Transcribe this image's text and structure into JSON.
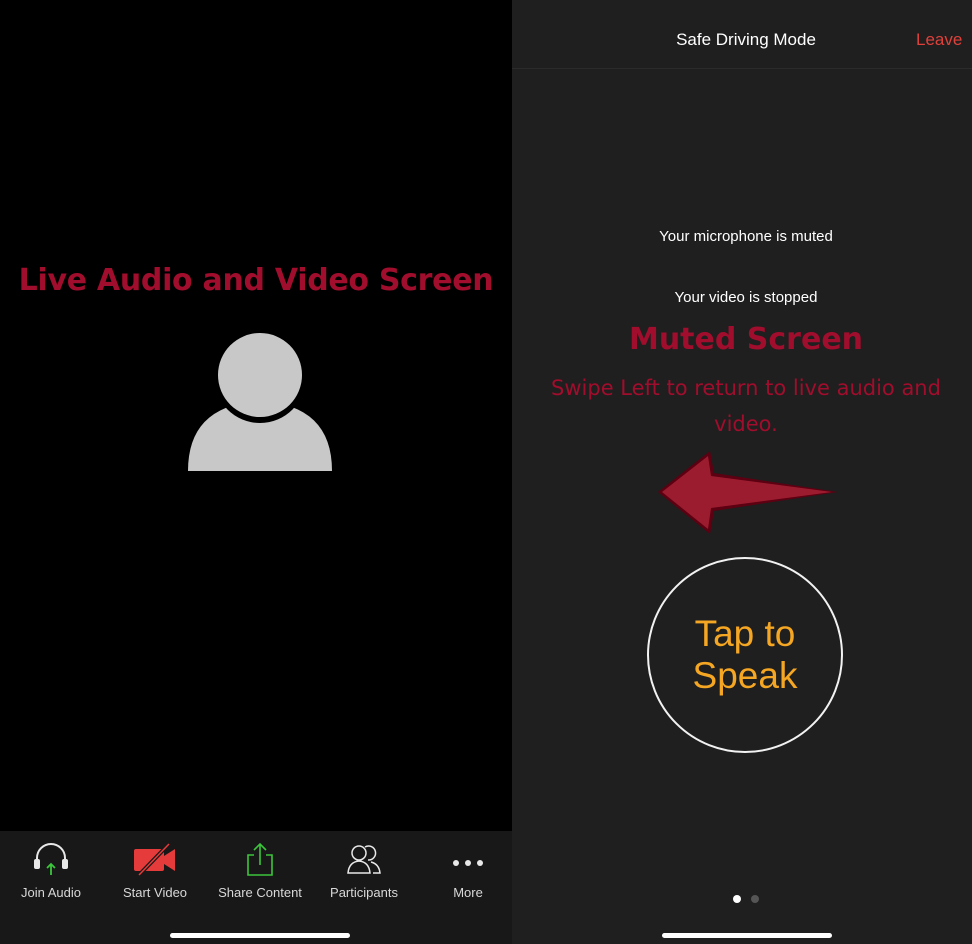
{
  "left_panel": {
    "annotation": "Live Audio and Video Screen",
    "toolbar": [
      {
        "label": "Join Audio",
        "icon": "headphones-icon"
      },
      {
        "label": "Start Video",
        "icon": "video-off-icon"
      },
      {
        "label": "Share Content",
        "icon": "share-icon"
      },
      {
        "label": "Participants",
        "icon": "participants-icon"
      },
      {
        "label": "More",
        "icon": "more-icon"
      }
    ]
  },
  "right_panel": {
    "header": {
      "title": "Safe Driving Mode",
      "leave_label": "Leave"
    },
    "microphone_status": "Your microphone is muted",
    "video_status": "Your video is stopped",
    "annotation_title": "Muted Screen",
    "annotation_instruction": "Swipe Left to return to live audio and video.",
    "tap_button_label": "Tap to Speak",
    "page_indicator": {
      "current": 1,
      "total": 2
    }
  },
  "colors": {
    "annotation": "#a10d2c",
    "leave": "#e0403a",
    "tap_label": "#f5a623",
    "share_green": "#3cc63c",
    "video_red": "#e53b3b"
  }
}
